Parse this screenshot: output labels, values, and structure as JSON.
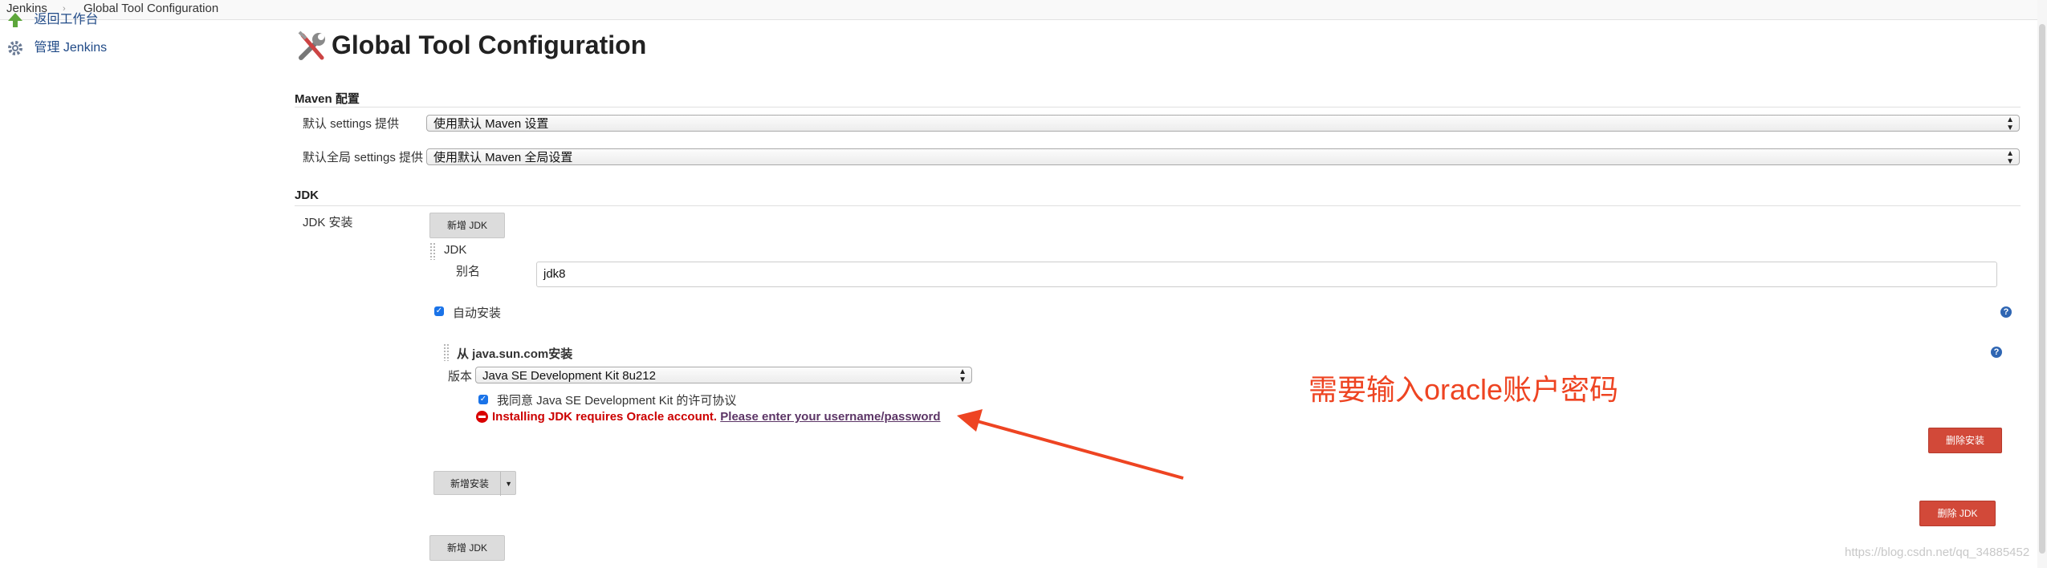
{
  "breadcrumb": {
    "root": "Jenkins",
    "current": "Global Tool Configuration"
  },
  "sidebar": {
    "items": [
      {
        "label": "返回工作台"
      },
      {
        "label": "管理 Jenkins"
      }
    ]
  },
  "page": {
    "title": "Global Tool Configuration"
  },
  "maven": {
    "section_title": "Maven 配置",
    "settings_label": "默认 settings 提供",
    "settings_value": "使用默认 Maven 设置",
    "global_settings_label": "默认全局 settings 提供",
    "global_settings_value": "使用默认 Maven 全局设置"
  },
  "jdk": {
    "section_title": "JDK",
    "install_label": "JDK 安装",
    "add_jdk_button": "新增 JDK",
    "item_title": "JDK",
    "alias_label": "别名",
    "alias_value": "jdk8",
    "auto_install_label": "自动安装",
    "installer_title": "从 java.sun.com安装",
    "version_label": "版本",
    "version_value": "Java SE Development Kit 8u212",
    "agree_label": "我同意 Java SE Development Kit 的许可协议",
    "error_text": "Installing JDK requires Oracle account.",
    "error_link": "Please enter your username/password",
    "delete_installer_button": "删除安装",
    "add_installer_button": "新增安装",
    "delete_jdk_button": "删除 JDK",
    "add_jdk_button_bottom": "新增 JDK"
  },
  "annotation": {
    "text": "需要输入oracle账户密码",
    "color": "#ee4422"
  },
  "watermark": {
    "text": "https://blog.csdn.net/qq_34885452"
  },
  "icons": {
    "back": "arrow-up-icon",
    "manage": "gear-icon",
    "title": "tools-icon",
    "help": "help-icon",
    "error": "error-icon"
  },
  "colors": {
    "danger_button": "#d24939",
    "error_text": "#cc0000",
    "link": "#5c3566",
    "checkbox": "#1a73e8"
  }
}
